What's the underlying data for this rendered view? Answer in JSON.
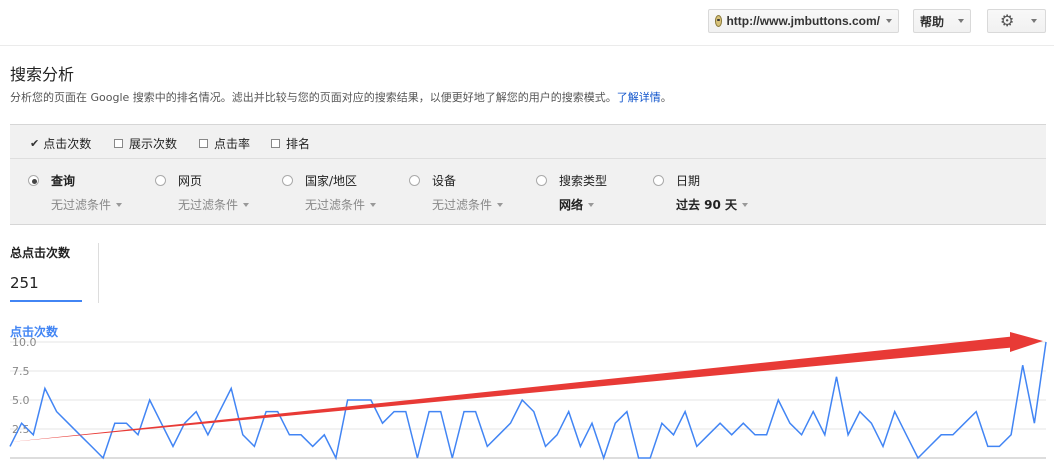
{
  "topbar": {
    "site_url": "http://www.jmbuttons.com/",
    "help_label": "帮助"
  },
  "page": {
    "title": "搜索分析",
    "description": "分析您的页面在 Google 搜索中的排名情况。滤出并比较与您的页面对应的搜索结果，以便更好地了解您的用户的搜索模式。",
    "learn_more": "了解详情",
    "learn_more_suffix": "。"
  },
  "metrics": [
    {
      "label": "点击次数",
      "checked": true
    },
    {
      "label": "展示次数",
      "checked": false
    },
    {
      "label": "点击率",
      "checked": false
    },
    {
      "label": "排名",
      "checked": false
    }
  ],
  "dimensions": [
    {
      "label": "查询",
      "filter": "无过滤条件",
      "selected": true
    },
    {
      "label": "网页",
      "filter": "无过滤条件",
      "selected": false
    },
    {
      "label": "国家/地区",
      "filter": "无过滤条件",
      "selected": false
    },
    {
      "label": "设备",
      "filter": "无过滤条件",
      "selected": false
    },
    {
      "label": "搜索类型",
      "filter": "网络",
      "selected": false
    },
    {
      "label": "日期",
      "filter": "过去 90 天",
      "selected": false
    }
  ],
  "summary": {
    "total_label": "总点击次数",
    "total_value": "251"
  },
  "chart_data": {
    "type": "line",
    "series": [
      {
        "name": "点击次数",
        "values": [
          1,
          3,
          2,
          6,
          4,
          3,
          2,
          1,
          0,
          3,
          3,
          2,
          5,
          3,
          1,
          3,
          4,
          2,
          4,
          6,
          2,
          1,
          4,
          4,
          2,
          2,
          1,
          2,
          0,
          5,
          5,
          5,
          3,
          4,
          4,
          0,
          4,
          4,
          0,
          4,
          4,
          1,
          2,
          3,
          5,
          4,
          1,
          2,
          4,
          1,
          3,
          0,
          3,
          4,
          0,
          0,
          3,
          2,
          4,
          1,
          2,
          3,
          2,
          3,
          2,
          2,
          5,
          3,
          2,
          4,
          2,
          7,
          2,
          4,
          3,
          1,
          4,
          2,
          0,
          1,
          2,
          2,
          3,
          4,
          1,
          1,
          2,
          8,
          3,
          10
        ]
      }
    ],
    "ylim": [
      0,
      10
    ],
    "yticks": [
      "2.5",
      "5.0",
      "7.5",
      "10.0"
    ],
    "grid": true,
    "colors": {
      "line": "#4285f4",
      "arrow": "#e83a36"
    }
  }
}
